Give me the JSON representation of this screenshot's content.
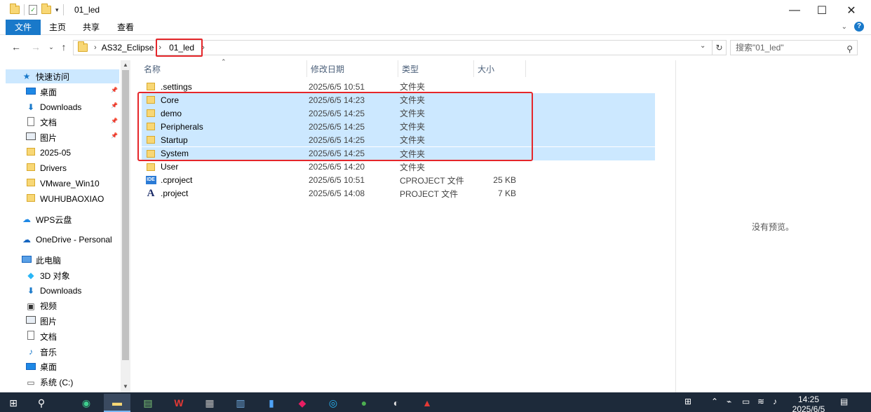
{
  "window": {
    "title": "01_led",
    "minimize_glyph": "—",
    "maximize_glyph": "☐",
    "close_glyph": "✕"
  },
  "ribbon": {
    "tabs": [
      "文件",
      "主页",
      "共享",
      "查看"
    ]
  },
  "address": {
    "crumbs": [
      "AS32_Eclipse",
      "01_led"
    ],
    "search_placeholder": "搜索\"01_led\""
  },
  "sidebar": {
    "quick_access": "快速访问",
    "quick_items": [
      {
        "label": "桌面",
        "icon": "desktop-icon",
        "pinned": true
      },
      {
        "label": "Downloads",
        "icon": "download-icon",
        "pinned": true
      },
      {
        "label": "文档",
        "icon": "document-icon",
        "pinned": true
      },
      {
        "label": "图片",
        "icon": "picture-icon",
        "pinned": true
      },
      {
        "label": "2025-05",
        "icon": "folder-icon",
        "pinned": false
      },
      {
        "label": "Drivers",
        "icon": "folder-icon",
        "pinned": false
      },
      {
        "label": "VMware_Win10",
        "icon": "folder-icon",
        "pinned": false
      },
      {
        "label": "WUHUBAOXIAO",
        "icon": "folder-icon",
        "pinned": false
      }
    ],
    "wps": "WPS云盘",
    "onedrive": "OneDrive - Personal",
    "this_pc": "此电脑",
    "pc_items": [
      {
        "label": "3D 对象",
        "icon": "3d-objects-icon"
      },
      {
        "label": "Downloads",
        "icon": "download-icon"
      },
      {
        "label": "视频",
        "icon": "video-icon"
      },
      {
        "label": "图片",
        "icon": "picture-icon"
      },
      {
        "label": "文档",
        "icon": "document-icon"
      },
      {
        "label": "音乐",
        "icon": "music-icon"
      },
      {
        "label": "桌面",
        "icon": "desktop-icon"
      },
      {
        "label": "系统 (C:)",
        "icon": "drive-icon"
      }
    ]
  },
  "columns": [
    "名称",
    "修改日期",
    "类型",
    "大小"
  ],
  "files": [
    {
      "name": ".settings",
      "date": "2025/6/5 10:51",
      "type": "文件夹",
      "size": "",
      "icon": "folder-icon",
      "selected": false
    },
    {
      "name": "Core",
      "date": "2025/6/5 14:23",
      "type": "文件夹",
      "size": "",
      "icon": "folder-icon",
      "selected": true
    },
    {
      "name": "demo",
      "date": "2025/6/5 14:25",
      "type": "文件夹",
      "size": "",
      "icon": "folder-icon",
      "selected": true
    },
    {
      "name": "Peripherals",
      "date": "2025/6/5 14:25",
      "type": "文件夹",
      "size": "",
      "icon": "folder-icon",
      "selected": true
    },
    {
      "name": "Startup",
      "date": "2025/6/5 14:25",
      "type": "文件夹",
      "size": "",
      "icon": "folder-icon",
      "selected": true
    },
    {
      "name": "System",
      "date": "2025/6/5 14:25",
      "type": "文件夹",
      "size": "",
      "icon": "folder-icon",
      "selected": true
    },
    {
      "name": "User",
      "date": "2025/6/5 14:20",
      "type": "文件夹",
      "size": "",
      "icon": "folder-icon",
      "selected": false
    },
    {
      "name": ".cproject",
      "date": "2025/6/5 10:51",
      "type": "CPROJECT 文件",
      "size": "25 KB",
      "icon": "ide-file-icon",
      "selected": false
    },
    {
      "name": ".project",
      "date": "2025/6/5 14:08",
      "type": "PROJECT 文件",
      "size": "7 KB",
      "icon": "project-file-icon",
      "selected": false
    }
  ],
  "preview": {
    "empty_text": "没有预览。"
  },
  "taskbar": {
    "time": "14:25",
    "date": "2025/6/5",
    "colors": {
      "background": "#1d2a3a",
      "selection": "#cce8ff",
      "highlight_box": "#e5262a",
      "accent": "#1979ca"
    }
  }
}
